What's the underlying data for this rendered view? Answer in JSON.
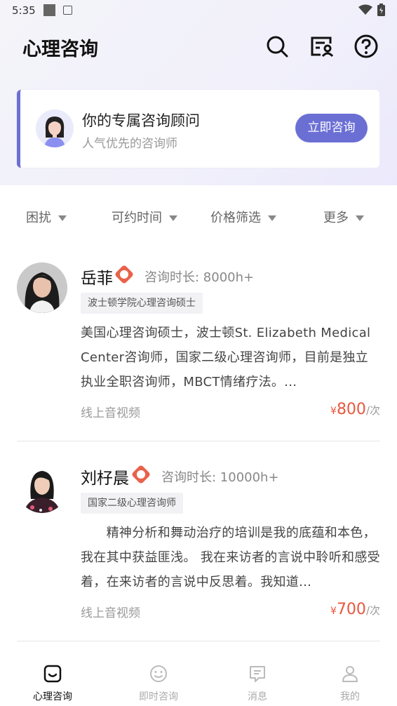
{
  "status": {
    "time": "5:35"
  },
  "header": {
    "title": "心理咨询"
  },
  "advisor": {
    "title": "你的专属咨询顾问",
    "subtitle": "人气优先的咨询师",
    "button": "立即咨询"
  },
  "filters": [
    {
      "label": "困扰"
    },
    {
      "label": "可约时间"
    },
    {
      "label": "价格筛选"
    },
    {
      "label": "更多"
    }
  ],
  "counselors": [
    {
      "name": "岳菲",
      "duration": "咨询时长: 8000h+",
      "tag": "波士顿学院心理咨询硕士",
      "bio": "美国心理咨询硕士，波士顿St. Elizabeth Medical Center咨询师，国家二级心理咨询师，目前是独立执业全职咨询师，MBCT情绪疗法。...",
      "mode": "线上音视频",
      "currency": "¥",
      "price": "800",
      "unit": "/次"
    },
    {
      "name": "刘杍晨",
      "duration": "咨询时长: 10000h+",
      "tag": "国家二级心理咨询师",
      "bio": "　　精神分析和舞动治疗的培训是我的底蕴和本色，我在其中获益匪浅。 我在来访者的言说中聆听和感受着，在来访者的言说中反思着。我知道...",
      "mode": "线上音视频",
      "currency": "¥",
      "price": "700",
      "unit": "/次"
    }
  ],
  "nav": [
    {
      "label": "心理咨询",
      "icon": "consult-icon",
      "active": true
    },
    {
      "label": "即时咨询",
      "icon": "smile-icon",
      "active": false
    },
    {
      "label": "消息",
      "icon": "message-icon",
      "active": false
    },
    {
      "label": "我的",
      "icon": "user-icon",
      "active": false
    }
  ],
  "colors": {
    "accent": "#6b6fd4",
    "price": "#e8573f",
    "badge": "#e8624a"
  }
}
